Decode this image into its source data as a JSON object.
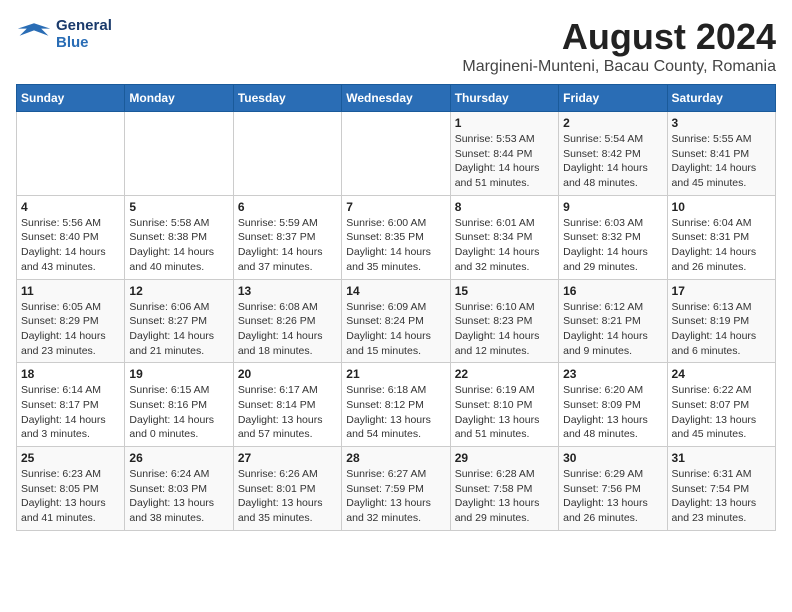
{
  "header": {
    "logo_line1": "General",
    "logo_line2": "Blue",
    "main_title": "August 2024",
    "subtitle": "Margineni-Munteni, Bacau County, Romania"
  },
  "weekdays": [
    "Sunday",
    "Monday",
    "Tuesday",
    "Wednesday",
    "Thursday",
    "Friday",
    "Saturday"
  ],
  "weeks": [
    [
      {
        "day": "",
        "detail": ""
      },
      {
        "day": "",
        "detail": ""
      },
      {
        "day": "",
        "detail": ""
      },
      {
        "day": "",
        "detail": ""
      },
      {
        "day": "1",
        "detail": "Sunrise: 5:53 AM\nSunset: 8:44 PM\nDaylight: 14 hours and 51 minutes."
      },
      {
        "day": "2",
        "detail": "Sunrise: 5:54 AM\nSunset: 8:42 PM\nDaylight: 14 hours and 48 minutes."
      },
      {
        "day": "3",
        "detail": "Sunrise: 5:55 AM\nSunset: 8:41 PM\nDaylight: 14 hours and 45 minutes."
      }
    ],
    [
      {
        "day": "4",
        "detail": "Sunrise: 5:56 AM\nSunset: 8:40 PM\nDaylight: 14 hours and 43 minutes."
      },
      {
        "day": "5",
        "detail": "Sunrise: 5:58 AM\nSunset: 8:38 PM\nDaylight: 14 hours and 40 minutes."
      },
      {
        "day": "6",
        "detail": "Sunrise: 5:59 AM\nSunset: 8:37 PM\nDaylight: 14 hours and 37 minutes."
      },
      {
        "day": "7",
        "detail": "Sunrise: 6:00 AM\nSunset: 8:35 PM\nDaylight: 14 hours and 35 minutes."
      },
      {
        "day": "8",
        "detail": "Sunrise: 6:01 AM\nSunset: 8:34 PM\nDaylight: 14 hours and 32 minutes."
      },
      {
        "day": "9",
        "detail": "Sunrise: 6:03 AM\nSunset: 8:32 PM\nDaylight: 14 hours and 29 minutes."
      },
      {
        "day": "10",
        "detail": "Sunrise: 6:04 AM\nSunset: 8:31 PM\nDaylight: 14 hours and 26 minutes."
      }
    ],
    [
      {
        "day": "11",
        "detail": "Sunrise: 6:05 AM\nSunset: 8:29 PM\nDaylight: 14 hours and 23 minutes."
      },
      {
        "day": "12",
        "detail": "Sunrise: 6:06 AM\nSunset: 8:27 PM\nDaylight: 14 hours and 21 minutes."
      },
      {
        "day": "13",
        "detail": "Sunrise: 6:08 AM\nSunset: 8:26 PM\nDaylight: 14 hours and 18 minutes."
      },
      {
        "day": "14",
        "detail": "Sunrise: 6:09 AM\nSunset: 8:24 PM\nDaylight: 14 hours and 15 minutes."
      },
      {
        "day": "15",
        "detail": "Sunrise: 6:10 AM\nSunset: 8:23 PM\nDaylight: 14 hours and 12 minutes."
      },
      {
        "day": "16",
        "detail": "Sunrise: 6:12 AM\nSunset: 8:21 PM\nDaylight: 14 hours and 9 minutes."
      },
      {
        "day": "17",
        "detail": "Sunrise: 6:13 AM\nSunset: 8:19 PM\nDaylight: 14 hours and 6 minutes."
      }
    ],
    [
      {
        "day": "18",
        "detail": "Sunrise: 6:14 AM\nSunset: 8:17 PM\nDaylight: 14 hours and 3 minutes."
      },
      {
        "day": "19",
        "detail": "Sunrise: 6:15 AM\nSunset: 8:16 PM\nDaylight: 14 hours and 0 minutes."
      },
      {
        "day": "20",
        "detail": "Sunrise: 6:17 AM\nSunset: 8:14 PM\nDaylight: 13 hours and 57 minutes."
      },
      {
        "day": "21",
        "detail": "Sunrise: 6:18 AM\nSunset: 8:12 PM\nDaylight: 13 hours and 54 minutes."
      },
      {
        "day": "22",
        "detail": "Sunrise: 6:19 AM\nSunset: 8:10 PM\nDaylight: 13 hours and 51 minutes."
      },
      {
        "day": "23",
        "detail": "Sunrise: 6:20 AM\nSunset: 8:09 PM\nDaylight: 13 hours and 48 minutes."
      },
      {
        "day": "24",
        "detail": "Sunrise: 6:22 AM\nSunset: 8:07 PM\nDaylight: 13 hours and 45 minutes."
      }
    ],
    [
      {
        "day": "25",
        "detail": "Sunrise: 6:23 AM\nSunset: 8:05 PM\nDaylight: 13 hours and 41 minutes."
      },
      {
        "day": "26",
        "detail": "Sunrise: 6:24 AM\nSunset: 8:03 PM\nDaylight: 13 hours and 38 minutes."
      },
      {
        "day": "27",
        "detail": "Sunrise: 6:26 AM\nSunset: 8:01 PM\nDaylight: 13 hours and 35 minutes."
      },
      {
        "day": "28",
        "detail": "Sunrise: 6:27 AM\nSunset: 7:59 PM\nDaylight: 13 hours and 32 minutes."
      },
      {
        "day": "29",
        "detail": "Sunrise: 6:28 AM\nSunset: 7:58 PM\nDaylight: 13 hours and 29 minutes."
      },
      {
        "day": "30",
        "detail": "Sunrise: 6:29 AM\nSunset: 7:56 PM\nDaylight: 13 hours and 26 minutes."
      },
      {
        "day": "31",
        "detail": "Sunrise: 6:31 AM\nSunset: 7:54 PM\nDaylight: 13 hours and 23 minutes."
      }
    ]
  ]
}
